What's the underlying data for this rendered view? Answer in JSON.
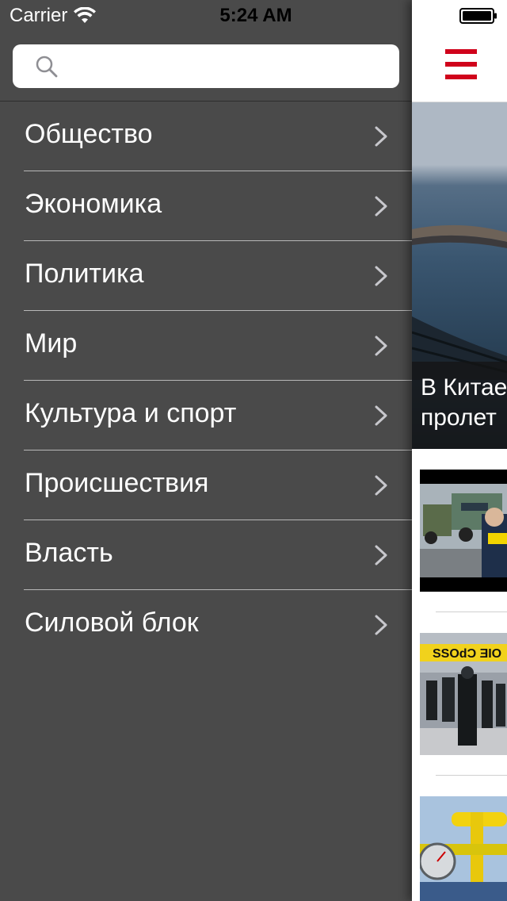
{
  "status_bar": {
    "carrier": "Carrier",
    "time": "5:24 AM"
  },
  "search": {
    "placeholder": "",
    "value": ""
  },
  "menu": {
    "items": [
      {
        "label": "Общество"
      },
      {
        "label": "Экономика"
      },
      {
        "label": "Политика"
      },
      {
        "label": "Мир"
      },
      {
        "label": "Культура и спорт"
      },
      {
        "label": "Происшествия"
      },
      {
        "label": "Власть"
      },
      {
        "label": "Силовой блок"
      }
    ]
  },
  "main": {
    "hero_title": "В Китае\nпролет",
    "accent_color": "#d0021b"
  },
  "icons": {
    "search": "search-icon",
    "chevron": "chevron-right-icon",
    "menu": "hamburger-icon",
    "wifi": "wifi-icon",
    "battery": "battery-icon"
  }
}
